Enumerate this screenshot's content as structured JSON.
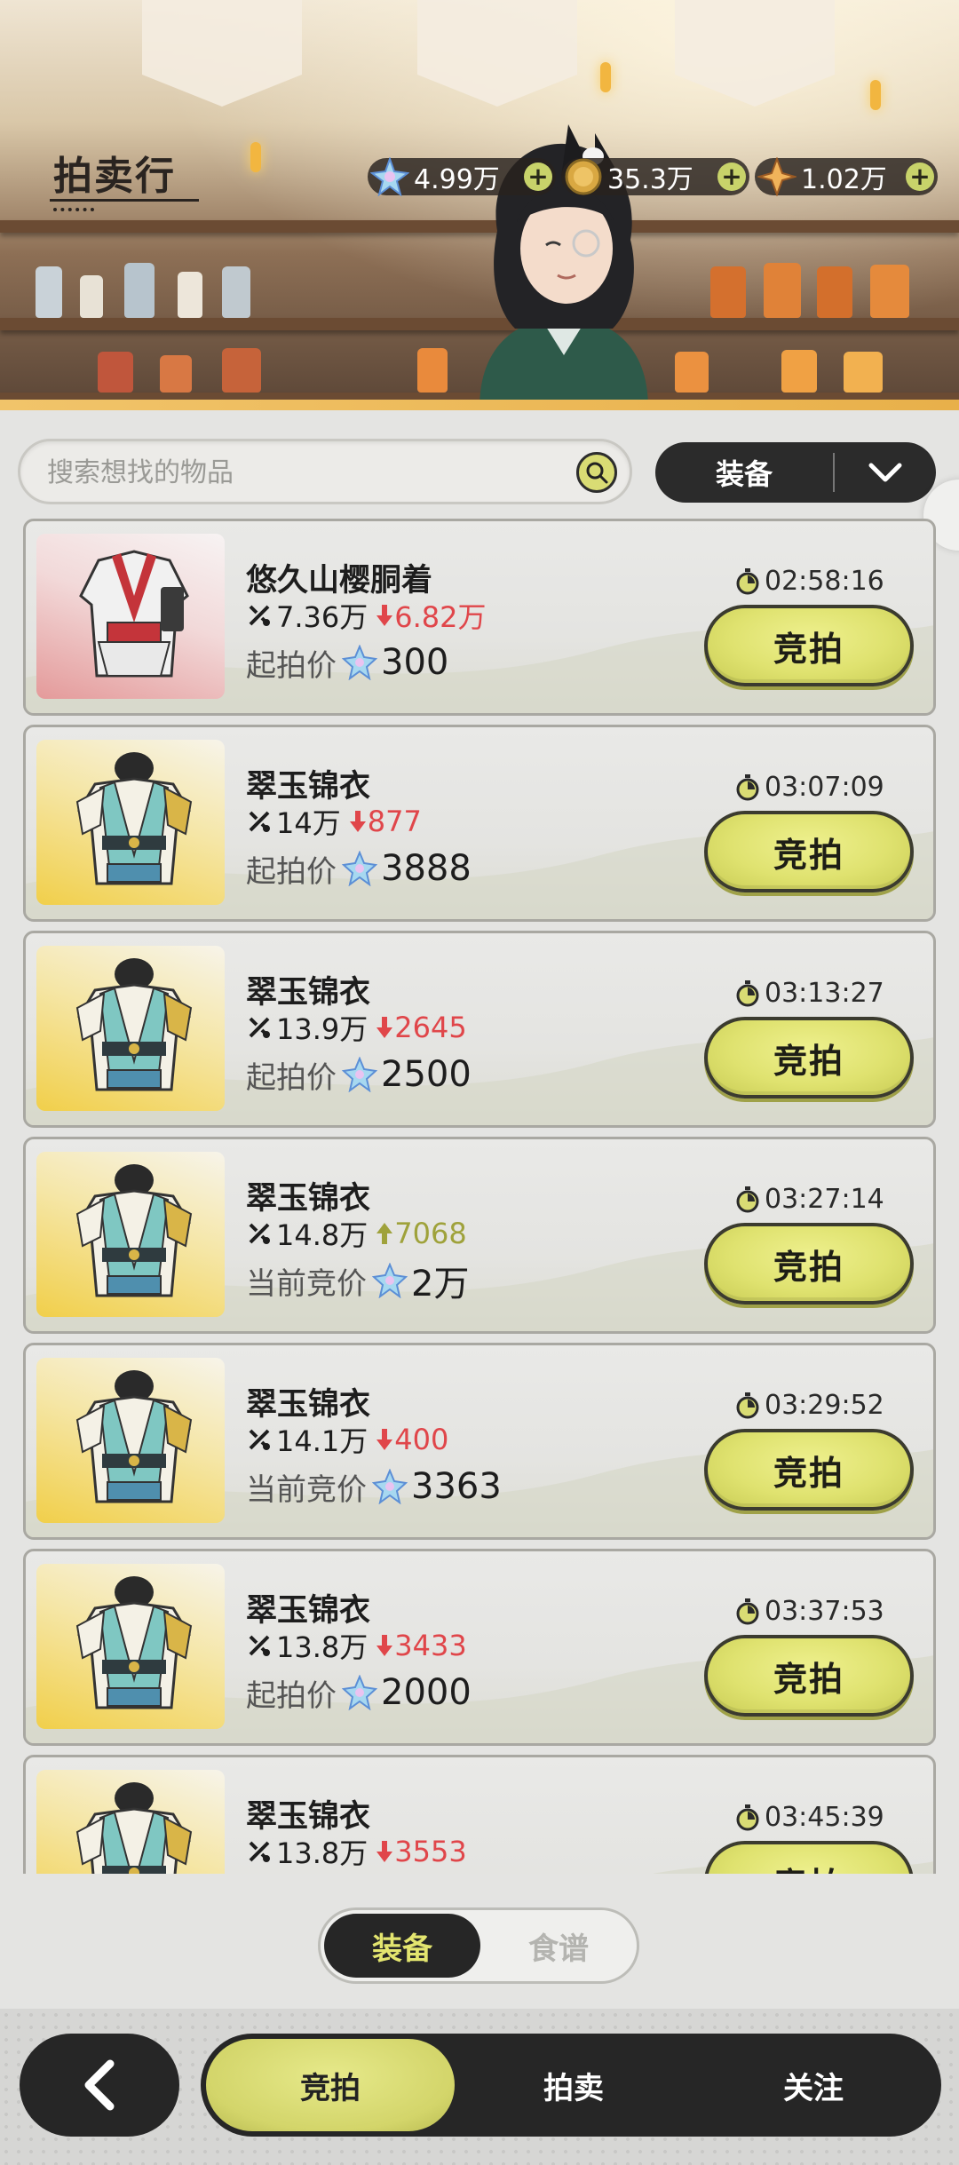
{
  "header": {
    "title": "拍卖行",
    "currencies": [
      {
        "icon": "crystal-icon",
        "value": "4.99万"
      },
      {
        "icon": "gold-coin-icon",
        "value": "35.3万"
      },
      {
        "icon": "star-shard-icon",
        "value": "1.02万"
      }
    ]
  },
  "search": {
    "placeholder": "搜索想找的物品",
    "category": "装备"
  },
  "items": [
    {
      "name": "悠久山樱胴着",
      "ref_price": "7.36万",
      "delta": "6.82万",
      "delta_dir": "down",
      "price_label": "起拍价",
      "price": "300",
      "timer": "02:58:16",
      "bid_label": "竞拍",
      "thumb": "red"
    },
    {
      "name": "翠玉锦衣",
      "ref_price": "14万",
      "delta": "877",
      "delta_dir": "down",
      "price_label": "起拍价",
      "price": "3888",
      "timer": "03:07:09",
      "bid_label": "竞拍",
      "thumb": "gold"
    },
    {
      "name": "翠玉锦衣",
      "ref_price": "13.9万",
      "delta": "2645",
      "delta_dir": "down",
      "price_label": "起拍价",
      "price": "2500",
      "timer": "03:13:27",
      "bid_label": "竞拍",
      "thumb": "gold"
    },
    {
      "name": "翠玉锦衣",
      "ref_price": "14.8万",
      "delta": "7068",
      "delta_dir": "up",
      "price_label": "当前竞价",
      "price": "2万",
      "timer": "03:27:14",
      "bid_label": "竞拍",
      "thumb": "gold"
    },
    {
      "name": "翠玉锦衣",
      "ref_price": "14.1万",
      "delta": "400",
      "delta_dir": "down",
      "price_label": "当前竞价",
      "price": "3363",
      "timer": "03:29:52",
      "bid_label": "竞拍",
      "thumb": "gold"
    },
    {
      "name": "翠玉锦衣",
      "ref_price": "13.8万",
      "delta": "3433",
      "delta_dir": "down",
      "price_label": "起拍价",
      "price": "2000",
      "timer": "03:37:53",
      "bid_label": "竞拍",
      "thumb": "gold"
    },
    {
      "name": "翠玉锦衣",
      "ref_price": "13.8万",
      "delta": "3553",
      "delta_dir": "down",
      "price_label": "",
      "price": "",
      "timer": "03:45:39",
      "bid_label": "竞拍",
      "thumb": "gold"
    }
  ],
  "filter_toggle": {
    "options": [
      "装备",
      "食谱"
    ],
    "active": "装备"
  },
  "bottom_nav": {
    "tabs": [
      "竞拍",
      "拍卖",
      "关注"
    ],
    "active": "竞拍"
  },
  "colors": {
    "accent": "#dfe26f",
    "dark": "#262626",
    "down": "#e0464a",
    "up": "#9fa23b"
  }
}
